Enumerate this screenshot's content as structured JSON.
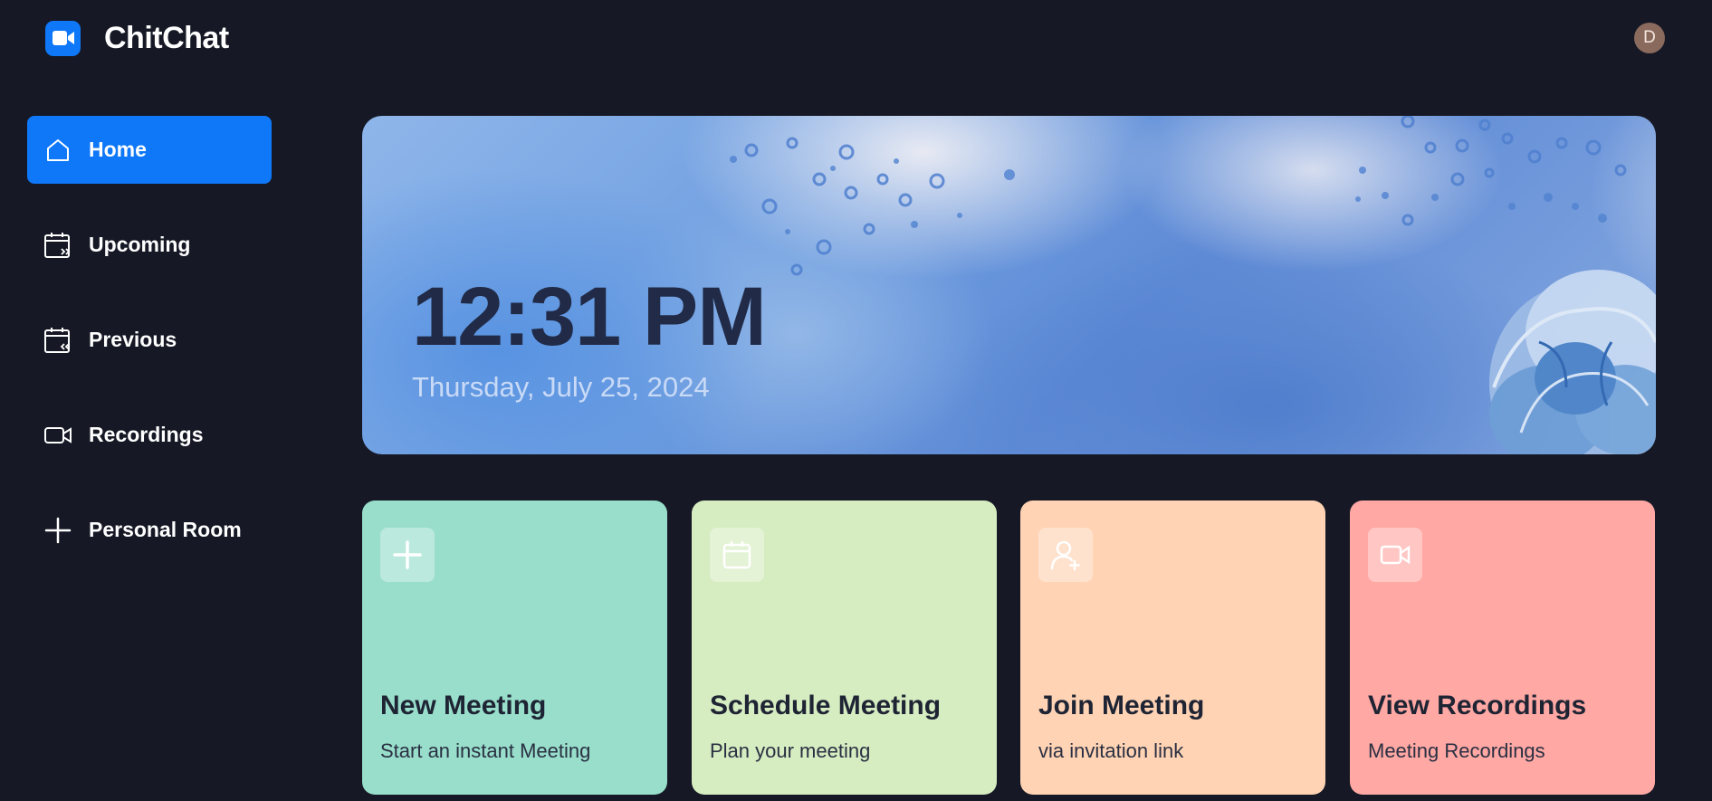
{
  "app": {
    "name": "ChitChat",
    "avatar_initial": "D"
  },
  "icons": {
    "logo": "video-camera-icon",
    "home": "home-icon",
    "upcoming": "calendar-forward-icon",
    "previous": "calendar-back-icon",
    "recordings": "video-camera-icon",
    "personal_room": "plus-icon"
  },
  "sidebar": {
    "items": [
      {
        "label": "Home",
        "active": true
      },
      {
        "label": "Upcoming",
        "active": false
      },
      {
        "label": "Previous",
        "active": false
      },
      {
        "label": "Recordings",
        "active": false
      },
      {
        "label": "Personal Room",
        "active": false
      }
    ]
  },
  "hero": {
    "time": "12:31 PM",
    "date": "Thursday, July 25, 2024"
  },
  "cards": [
    {
      "title": "New Meeting",
      "subtitle": "Start an instant Meeting",
      "color": "#98decb",
      "icon": "plus-icon"
    },
    {
      "title": "Schedule Meeting",
      "subtitle": "Plan your meeting",
      "color": "#d6ecc1",
      "icon": "calendar-icon"
    },
    {
      "title": "Join Meeting",
      "subtitle": "via invitation link",
      "color": "#ffd3b4",
      "icon": "add-user-icon"
    },
    {
      "title": "View Recordings",
      "subtitle": "Meeting Recordings",
      "color": "#ffa8a4",
      "icon": "video-camera-icon"
    }
  ],
  "colors": {
    "background": "#161925",
    "accent": "#0e78f9"
  }
}
